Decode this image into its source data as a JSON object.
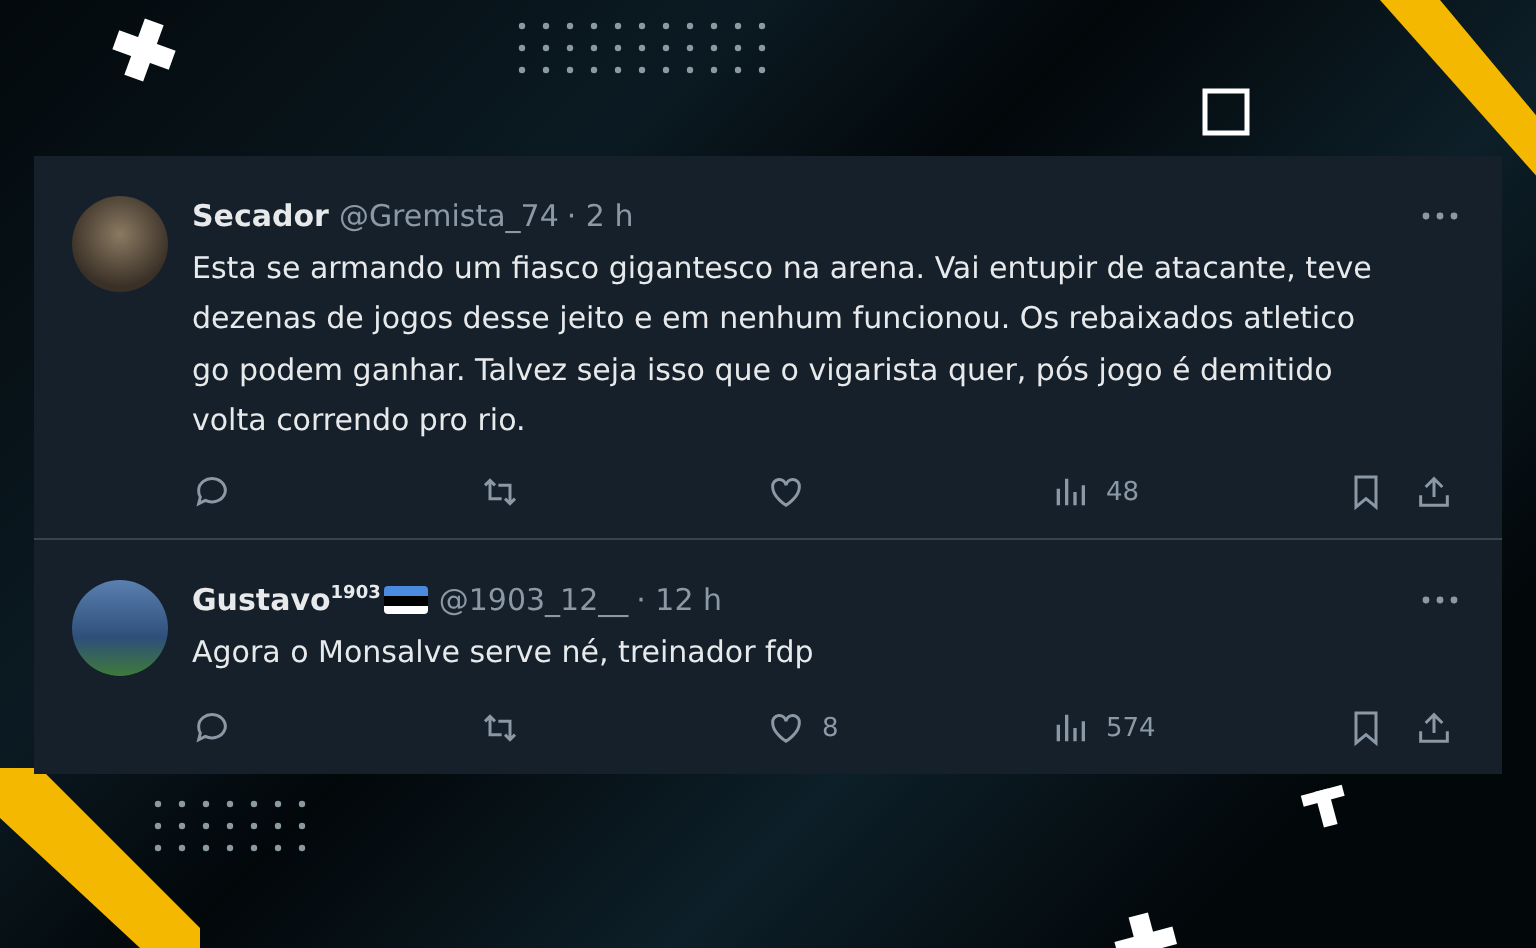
{
  "tweets": [
    {
      "name": "Secador",
      "flag_badge": false,
      "handle": "@Gremista_74",
      "time": "· 2 h",
      "text": "Esta se armando um fiasco gigantesco na arena. Vai entupir de atacante, teve dezenas de jogos desse jeito e em nenhum funcionou. Os rebaixados atletico go podem ganhar. Talvez seja isso que o vigarista quer, pós jogo é demitido volta correndo pro rio.",
      "views": "48"
    },
    {
      "name": "Gustavo$^{1903}$",
      "flag_badge": true,
      "handle": "@1903_12__",
      "time": "· 12 h",
      "text": "Agora o Monsalve serve né, treinador fdp",
      "likes": "8",
      "views": "574"
    }
  ]
}
